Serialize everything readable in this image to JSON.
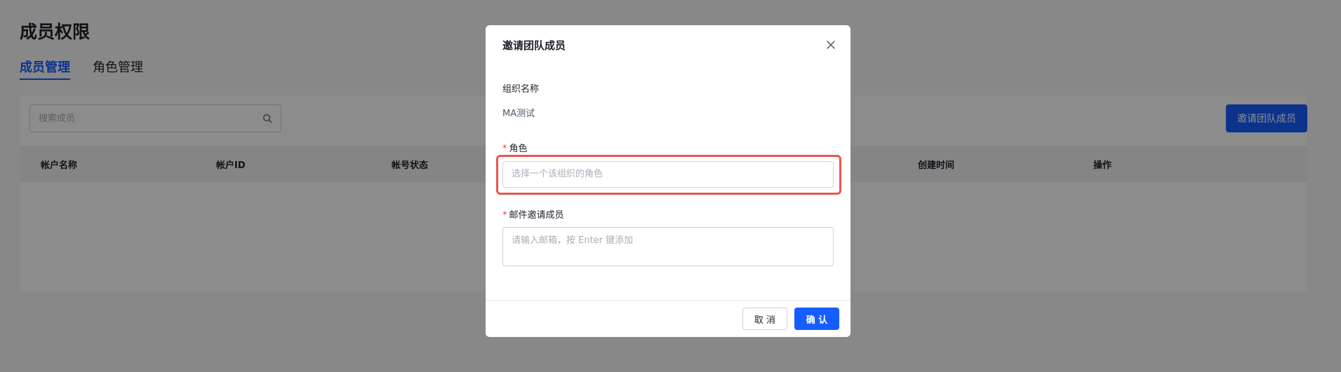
{
  "page": {
    "title": "成员权限",
    "tabs": [
      {
        "label": "成员管理",
        "active": true
      },
      {
        "label": "角色管理",
        "active": false
      }
    ]
  },
  "toolbar": {
    "search_placeholder": "搜索成员",
    "invite_label": "邀请团队成员"
  },
  "table": {
    "columns": [
      "帐户名称",
      "帐户ID",
      "帐号状态",
      "创建时间",
      "操作"
    ]
  },
  "modal": {
    "title": "邀请团队成员",
    "org_label": "组织名称",
    "org_value": "MA测试",
    "required_mark": "*",
    "role_label": "角色",
    "role_placeholder": "选择一个该组织的角色",
    "email_label": "邮件邀请成员",
    "email_placeholder": "请输入邮箱，按 Enter 键添加",
    "cancel_label": "取 消",
    "ok_label": "确 认"
  },
  "colors": {
    "primary": "#165dff",
    "required": "#f53f3f",
    "highlight": "#e9574e"
  },
  "icons": {
    "search": "search-icon",
    "close": "close-icon"
  }
}
